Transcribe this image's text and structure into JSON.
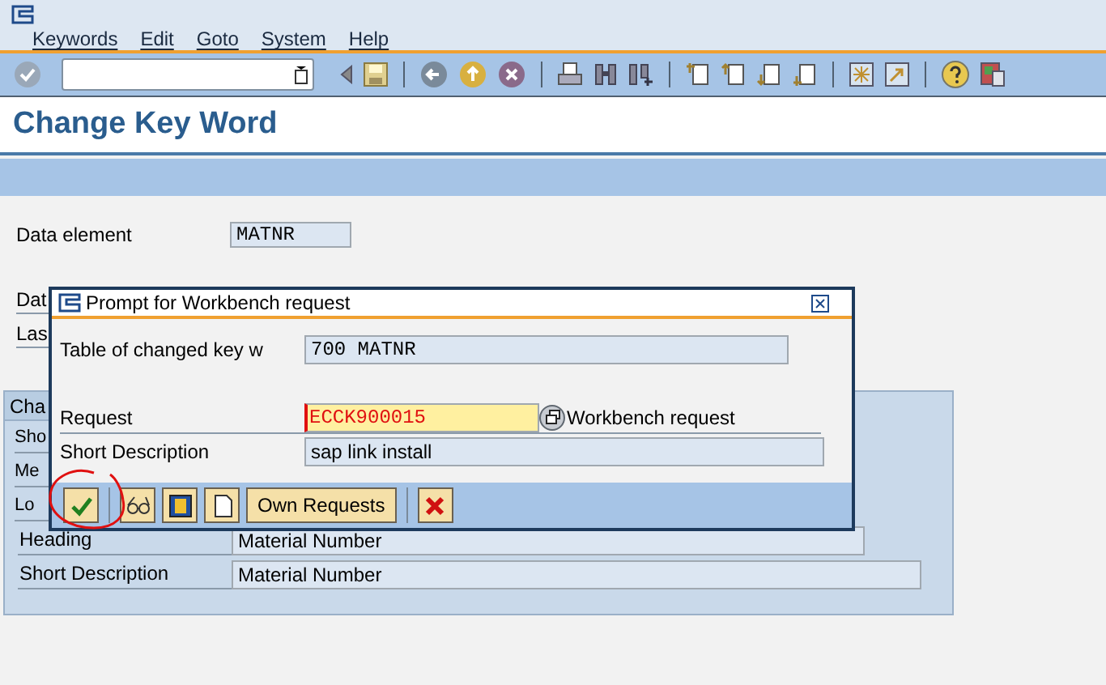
{
  "menu": [
    {
      "label": "Keywords"
    },
    {
      "label": "Edit"
    },
    {
      "label": "Goto"
    },
    {
      "label": "System"
    },
    {
      "label": "Help"
    }
  ],
  "title": "Change Key Word",
  "form": {
    "fields": [
      {
        "label": "Data element",
        "value": "MATNR"
      }
    ],
    "partial_labels": [
      "Dat",
      "Las"
    ]
  },
  "group": {
    "title": "Cha",
    "rows": [
      {
        "label": "Sho"
      },
      {
        "label": "Me"
      },
      {
        "label": "Lo"
      },
      {
        "label": "Heading",
        "value": "Material Number"
      },
      {
        "label": "Short Description",
        "value": "Material Number"
      }
    ]
  },
  "dialog": {
    "title": "Prompt for Workbench request",
    "fields": [
      {
        "kind": "display",
        "label": "Table of changed key w",
        "value": "700 MATNR"
      },
      {
        "kind": "request",
        "label": "Request",
        "value": "ECCK900015",
        "hint": "Workbench request"
      },
      {
        "kind": "display",
        "label": "Short Description",
        "value": "sap link install"
      }
    ],
    "buttons": [
      {
        "kind": "confirm"
      },
      {
        "kind": "display"
      },
      {
        "kind": "local"
      },
      {
        "kind": "create"
      },
      {
        "kind": "text",
        "label": "Own Requests"
      },
      {
        "kind": "cancel"
      }
    ]
  }
}
